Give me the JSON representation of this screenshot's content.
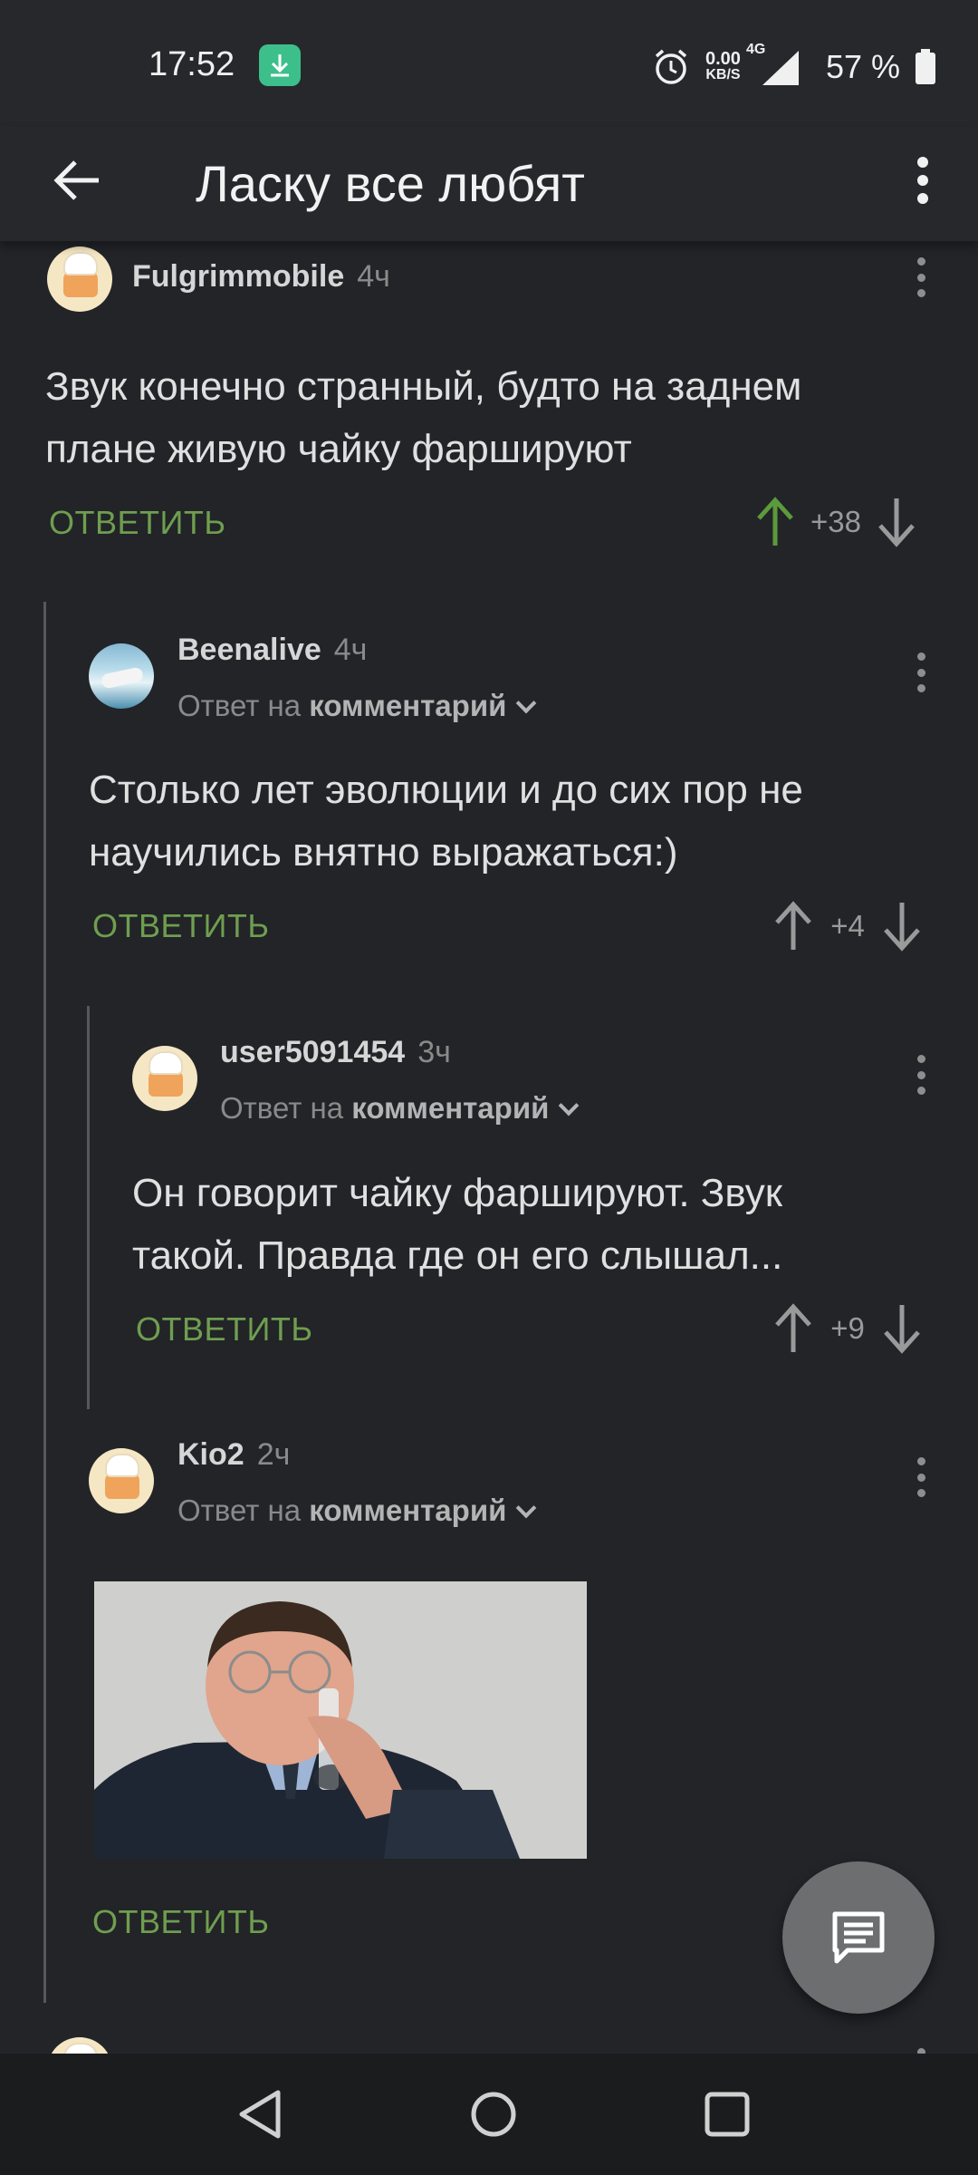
{
  "status_bar": {
    "time": "17:52",
    "net_rate": "0.00",
    "net_rate_unit": "KB/S",
    "network": "4G",
    "battery": "57 %"
  },
  "app_bar": {
    "title": "Ласку все любят"
  },
  "comments": [
    {
      "username": "Fulgrimmobile",
      "time": "4ч",
      "text_lines": [
        "Звук конечно странный, будто на заднем",
        "плане живую чайку фаршируют"
      ],
      "reply_label": "ОТВЕТИТЬ",
      "score": "+38"
    },
    {
      "username": "Beenalive",
      "time": "4ч",
      "reply_prefix": "Ответ на",
      "reply_target": "комментарий",
      "text_lines": [
        "Столько лет эволюции и до сих пор не",
        "научились внятно выражаться:)"
      ],
      "reply_label": "ОТВЕТИТЬ",
      "score": "+4"
    },
    {
      "username": "user5091454",
      "time": "3ч",
      "reply_prefix": "Ответ на",
      "reply_target": "комментарий",
      "text_lines": [
        "Он говорит чайку фаршируют. Звук",
        "такой. Правда где он его слышал..."
      ],
      "reply_label": "ОТВЕТИТЬ",
      "score": "+9"
    },
    {
      "username": "Kio2",
      "time": "2ч",
      "reply_prefix": "Ответ на",
      "reply_target": "комментарий",
      "reply_label": "ОТВЕТИТЬ"
    }
  ],
  "colors": {
    "accent_green": "#6f9e4f",
    "background": "#222428",
    "upvote_active": "#5c9a3c"
  },
  "icons": [
    "back-arrow-icon",
    "more-vert-icon",
    "upvote-icon",
    "downvote-icon",
    "comment-icon",
    "nav-back-icon",
    "nav-home-icon",
    "nav-recents-icon"
  ]
}
